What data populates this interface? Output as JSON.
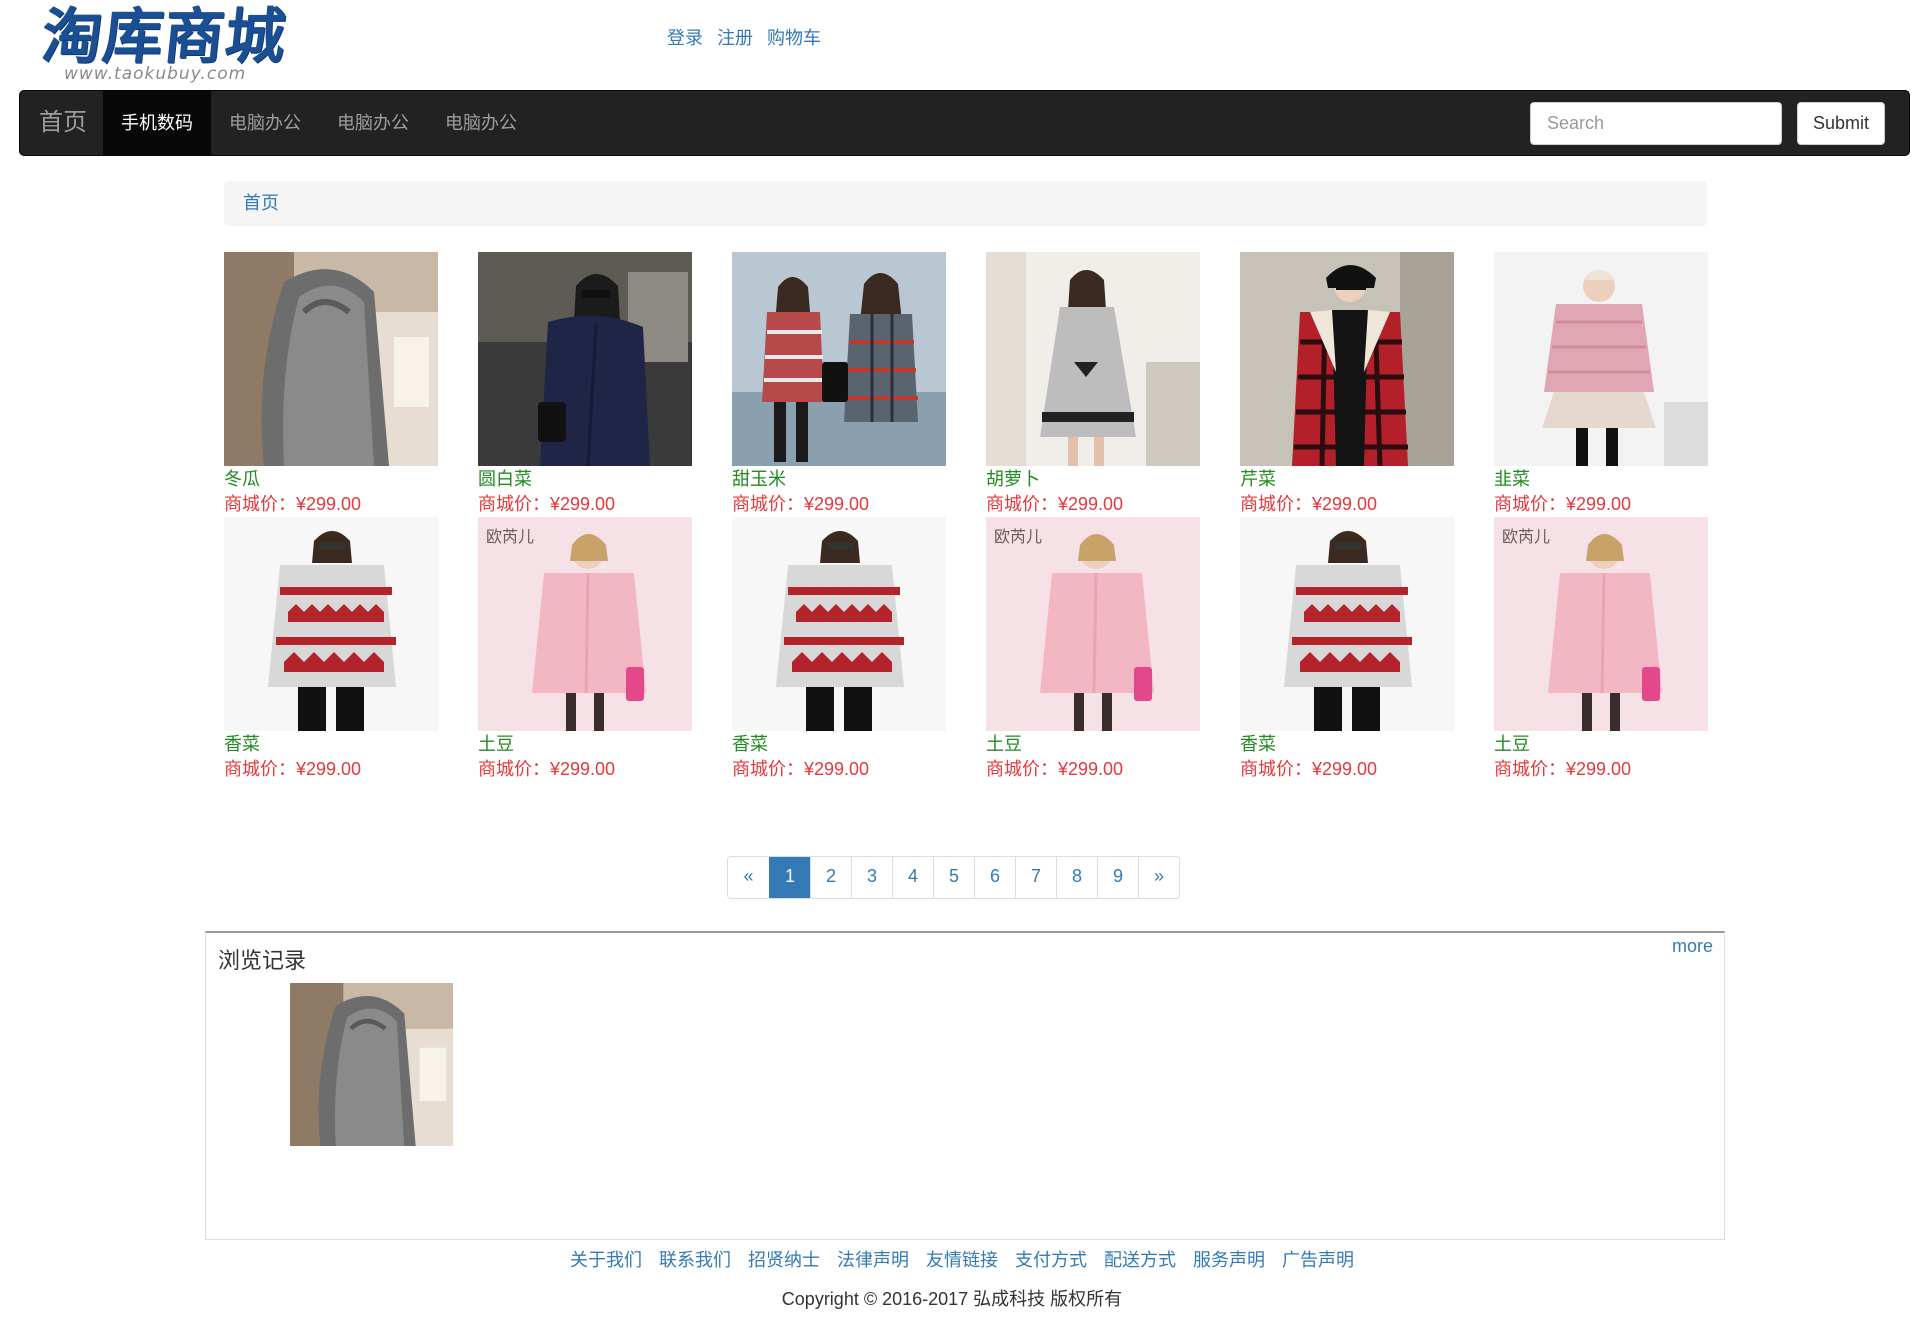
{
  "logo": {
    "title": "淘库商城",
    "subtitle": "www.taokubuy.com"
  },
  "top_links": [
    "登录",
    "注册",
    "购物车"
  ],
  "navbar": {
    "brand": "首页",
    "items": [
      "手机数码",
      "电脑办公",
      "电脑办公",
      "电脑办公"
    ],
    "active_index": 0,
    "search_placeholder": "Search",
    "submit_label": "Submit"
  },
  "breadcrumb": "首页",
  "products": [
    {
      "name": "冬瓜",
      "price": "商城价：¥299.00",
      "image": "gray-knit-hoodie"
    },
    {
      "name": "圆白菜",
      "price": "商城价：¥299.00",
      "image": "navy-wool-coat"
    },
    {
      "name": "甜玉米",
      "price": "商城价：¥299.00",
      "image": "plaid-coats"
    },
    {
      "name": "胡萝卜",
      "price": "商城价：¥299.00",
      "image": "gray-dress-coat"
    },
    {
      "name": "芹菜",
      "price": "商城价：¥299.00",
      "image": "red-plaid-jacket"
    },
    {
      "name": "韭菜",
      "price": "商城价：¥299.00",
      "image": "pink-sweater-dress"
    },
    {
      "name": "香菜",
      "price": "商城价：¥299.00",
      "image": "reindeer-sweater"
    },
    {
      "name": "土豆",
      "price": "商城价：¥299.00",
      "image": "pink-coat",
      "brand": "欧芮儿"
    },
    {
      "name": "香菜",
      "price": "商城价：¥299.00",
      "image": "reindeer-sweater"
    },
    {
      "name": "土豆",
      "price": "商城价：¥299.00",
      "image": "pink-coat",
      "brand": "欧芮儿"
    },
    {
      "name": "香菜",
      "price": "商城价：¥299.00",
      "image": "reindeer-sweater"
    },
    {
      "name": "土豆",
      "price": "商城价：¥299.00",
      "image": "pink-coat",
      "brand": "欧芮儿"
    }
  ],
  "pagination": {
    "prev": "«",
    "pages": [
      "1",
      "2",
      "3",
      "4",
      "5",
      "6",
      "7",
      "8",
      "9"
    ],
    "active": "1",
    "next": "»"
  },
  "history": {
    "title": "浏览记录",
    "more": "more",
    "items": [
      {
        "image": "gray-knit-hoodie"
      }
    ]
  },
  "footer": {
    "links": [
      "关于我们",
      "联系我们",
      "招贤纳士",
      "法律声明",
      "友情链接",
      "支付方式",
      "配送方式",
      "服务声明",
      "广告声明"
    ],
    "copyright": "Copyright © 2016-2017 弘成科技 版权所有"
  },
  "colors": {
    "link": "#337ab7",
    "navbar_bg": "#222222",
    "product_name": "#228b22",
    "price": "#e4393c",
    "logo": "#1a4f93"
  }
}
